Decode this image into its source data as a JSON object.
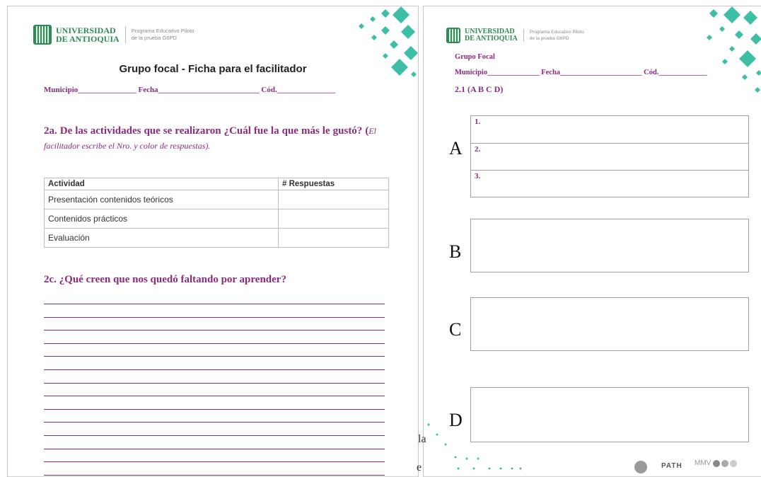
{
  "page1": {
    "logo": {
      "name_line1": "UNIVERSIDAD",
      "name_line2": "DE ANTIOQUIA",
      "program_line1": "Programa Educativo Piloto",
      "program_line2": "de la prueba G6PD"
    },
    "title": "Grupo focal - Ficha para el facilitador",
    "fields": "Municipio_______________ Fecha__________________________ Cód._______________",
    "question_2a": "2a. De las actividades que se realizaron ¿Cuál fue la que más le gustó? (",
    "question_2a_hint": "El facilitador escribe el Nro. y color de respuestas).",
    "table": {
      "headers": [
        "Actividad",
        "# Respuestas"
      ],
      "rows": [
        "Presentación contenidos teóricos",
        "Contenidos prácticos",
        "Evaluación"
      ]
    },
    "question_2c": "2c. ¿Qué creen que nos quedó faltando por aprender?"
  },
  "page2": {
    "logo": {
      "name_line1": "UNIVERSIDAD",
      "name_line2": "DE ANTIOQUIA",
      "program_line1": "Programa Educativo Piloto",
      "program_line2": "de la prueba G6PD"
    },
    "label_group": "Grupo Focal",
    "fields": "Municipio______________ Fecha______________________ Cód._____________",
    "section": "2.1 (A B C D)",
    "letters": [
      "A",
      "B",
      "C",
      "D"
    ],
    "a_items": [
      "1.",
      "2.",
      "3."
    ],
    "footer_logos": [
      "PATH",
      "MMV"
    ],
    "edge_chars": [
      "la",
      "e"
    ]
  },
  "colors": {
    "accent": "#8b2a7d",
    "brand_green": "#2f8a55",
    "deco_teal": "#3dbfa6"
  }
}
